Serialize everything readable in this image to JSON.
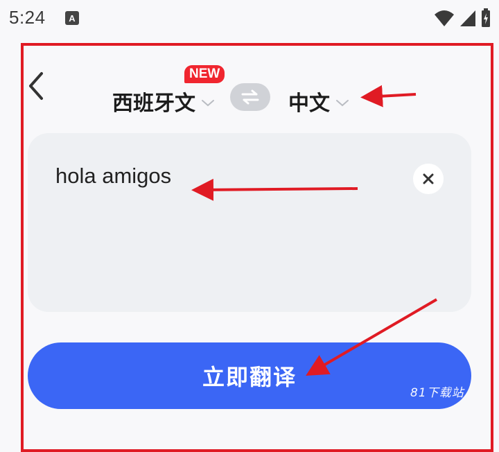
{
  "status_bar": {
    "time": "5:24",
    "app_icon_letter": "A"
  },
  "header": {
    "source_language": "西班牙文",
    "target_language": "中文",
    "new_badge": "NEW"
  },
  "input": {
    "text": "hola amigos"
  },
  "actions": {
    "translate_label": "立即翻译"
  },
  "watermark": "81下载站",
  "icons": {
    "back": "chevron-left-icon",
    "swap": "swap-arrows-icon",
    "clear": "close-icon",
    "dropdown": "chevron-down-icon",
    "wifi": "wifi-icon",
    "signal": "signal-icon",
    "battery": "battery-icon"
  },
  "colors": {
    "accent": "#3b66f5",
    "badge": "#f0262f",
    "annotation": "#e01b24",
    "card": "#eef0f3",
    "background": "#f8f8fa"
  }
}
